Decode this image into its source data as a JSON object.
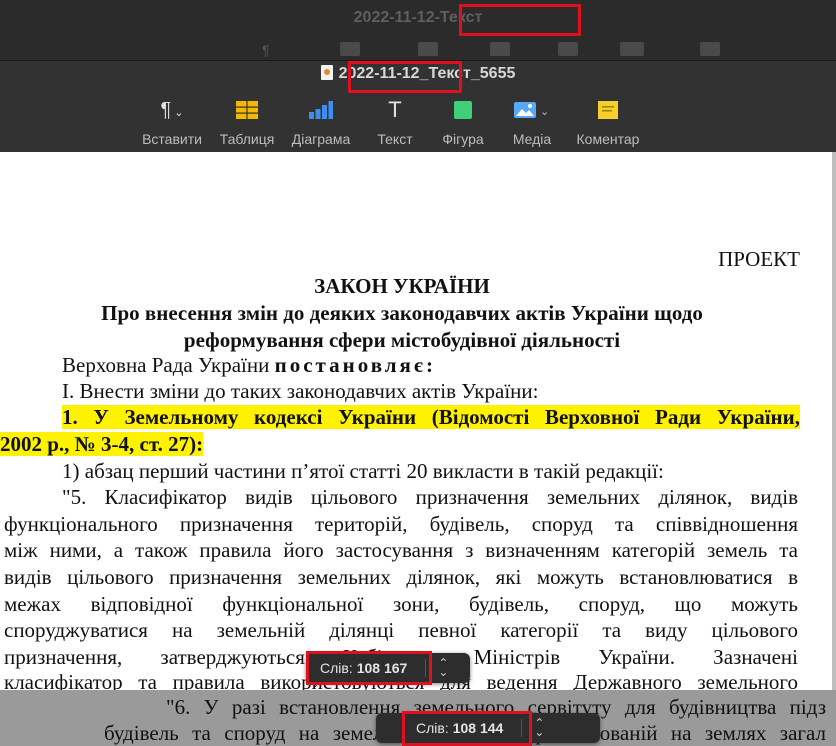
{
  "bg_window": {
    "title": "2022-11-12-Текст"
  },
  "window": {
    "title": "2022-11-12_Текст_5655",
    "title_highlighted": "2022-11-12_",
    "title_rest": "Текст_5655"
  },
  "toolbar": [
    {
      "id": "insert",
      "label": "Вставити",
      "icon": "paragraph-icon"
    },
    {
      "id": "table",
      "label": "Таблиця",
      "icon": "table-icon"
    },
    {
      "id": "chart",
      "label": "Діаграма",
      "icon": "chart-icon"
    },
    {
      "id": "text",
      "label": "Текст",
      "icon": "text-icon"
    },
    {
      "id": "shape",
      "label": "Фігура",
      "icon": "shape-icon"
    },
    {
      "id": "media",
      "label": "Медіа",
      "icon": "media-icon"
    },
    {
      "id": "comment",
      "label": "Коментар",
      "icon": "comment-icon"
    }
  ],
  "colors": {
    "highlight": "#fff200",
    "annotation": "#e0101e",
    "table_icon": "#f5b800",
    "chart_icon": "#3d8ef0",
    "shape_icon": "#3fd07a",
    "comment_icon": "#f7cf2a"
  },
  "document": {
    "project": "ПРОЕКТ",
    "law_title": "ЗАКОН УКРАЇНИ",
    "subtitle_1": "Про внесення змін до деяких законодавчих актів України щодо",
    "subtitle_2": "реформування сфери містобудівної діяльності",
    "resolves_prefix": "Верховна Рада України ",
    "resolves_word": "постановляє:",
    "item_I": "I. Внести зміни до таких законодавчих актів України:",
    "item_1_line1": "1. У Земельному кодексі України (Відомості Верховної Ради України,",
    "item_1_line2": "2002 р., № 3-4, ст. 27):",
    "sub_1": "1) абзац перший частини п’ятої статті 20 викласти в такій редакції:",
    "p1": "\"5. Класифікатор видів цільового призначення земельних ділянок, видів",
    "p2": "функціонального призначення територій, будівель, споруд та співвідношення",
    "p3": "між ними, а також правила його застосування з визначенням категорій земель та",
    "p4": "видів цільового призначення земельних ділянок, які можуть встановлюватися в",
    "p5": "межах відповідної функціональної зони, будівель, споруд, що можуть",
    "p6": "споруджуватися на земельній ділянці певної категорії та виду цільового",
    "p7": "призначення, затверджуються Кабінетом Міністрів України. Зазначені",
    "p8": "класифікатор та правила використовуються для ведення Державного земельного"
  },
  "lower_document": {
    "l1": "\"6. У разі встановлення земельного сервітуту для будівництва підз",
    "l2": "будівель та споруд на земельних ділянках, розташованій на землях загал"
  },
  "word_count_main": {
    "label": "Слів:",
    "value": "108 167"
  },
  "word_count_lower": {
    "label": "Слів:",
    "value": "108 144"
  }
}
